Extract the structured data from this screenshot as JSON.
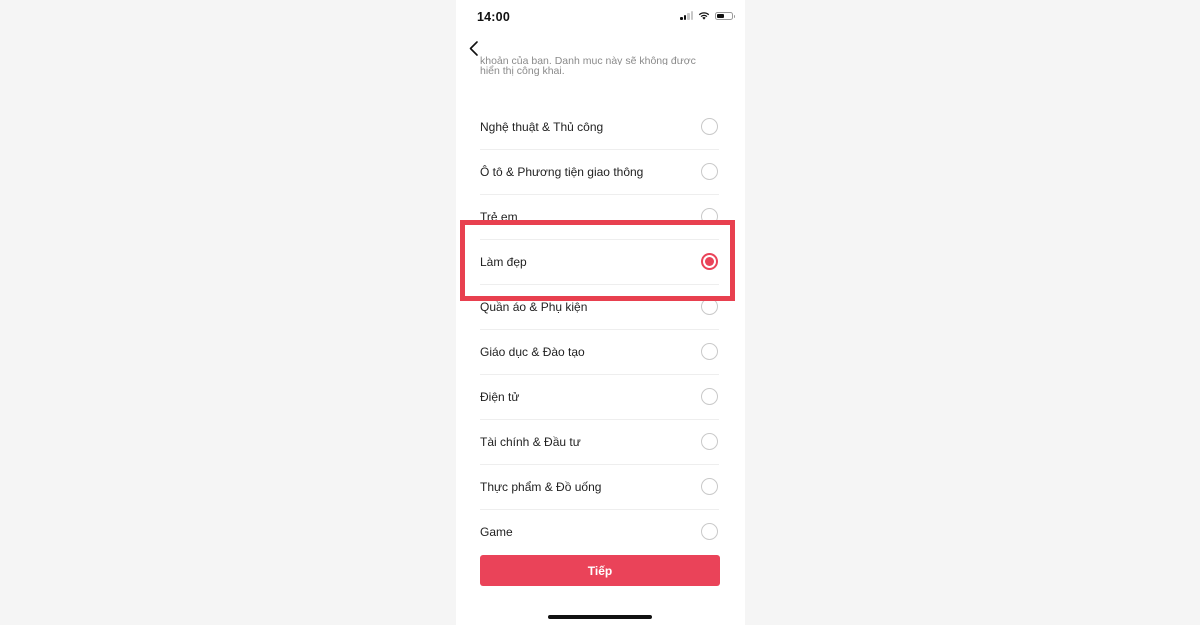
{
  "status_bar": {
    "time": "14:00"
  },
  "header": {
    "back_icon": "chevron-left-icon"
  },
  "description": {
    "line1": "khoản của bạn. Danh mục này sẽ không được",
    "line2": "hiển thị công khai."
  },
  "categories": [
    {
      "label": "Nghệ thuật & Thủ công",
      "selected": false
    },
    {
      "label": "Ô tô & Phương tiện giao thông",
      "selected": false
    },
    {
      "label": "Trẻ em",
      "selected": false
    },
    {
      "label": "Làm đẹp",
      "selected": true
    },
    {
      "label": "Quần áo & Phụ kiện",
      "selected": false
    },
    {
      "label": "Giáo dục & Đào tạo",
      "selected": false
    },
    {
      "label": "Điện tử",
      "selected": false
    },
    {
      "label": "Tài chính & Đầu tư",
      "selected": false
    },
    {
      "label": "Thực phẩm & Đồ uống",
      "selected": false
    },
    {
      "label": "Game",
      "selected": false
    }
  ],
  "next_button": {
    "label": "Tiếp"
  },
  "colors": {
    "accent": "#ea4359",
    "highlight": "#e8404f"
  }
}
